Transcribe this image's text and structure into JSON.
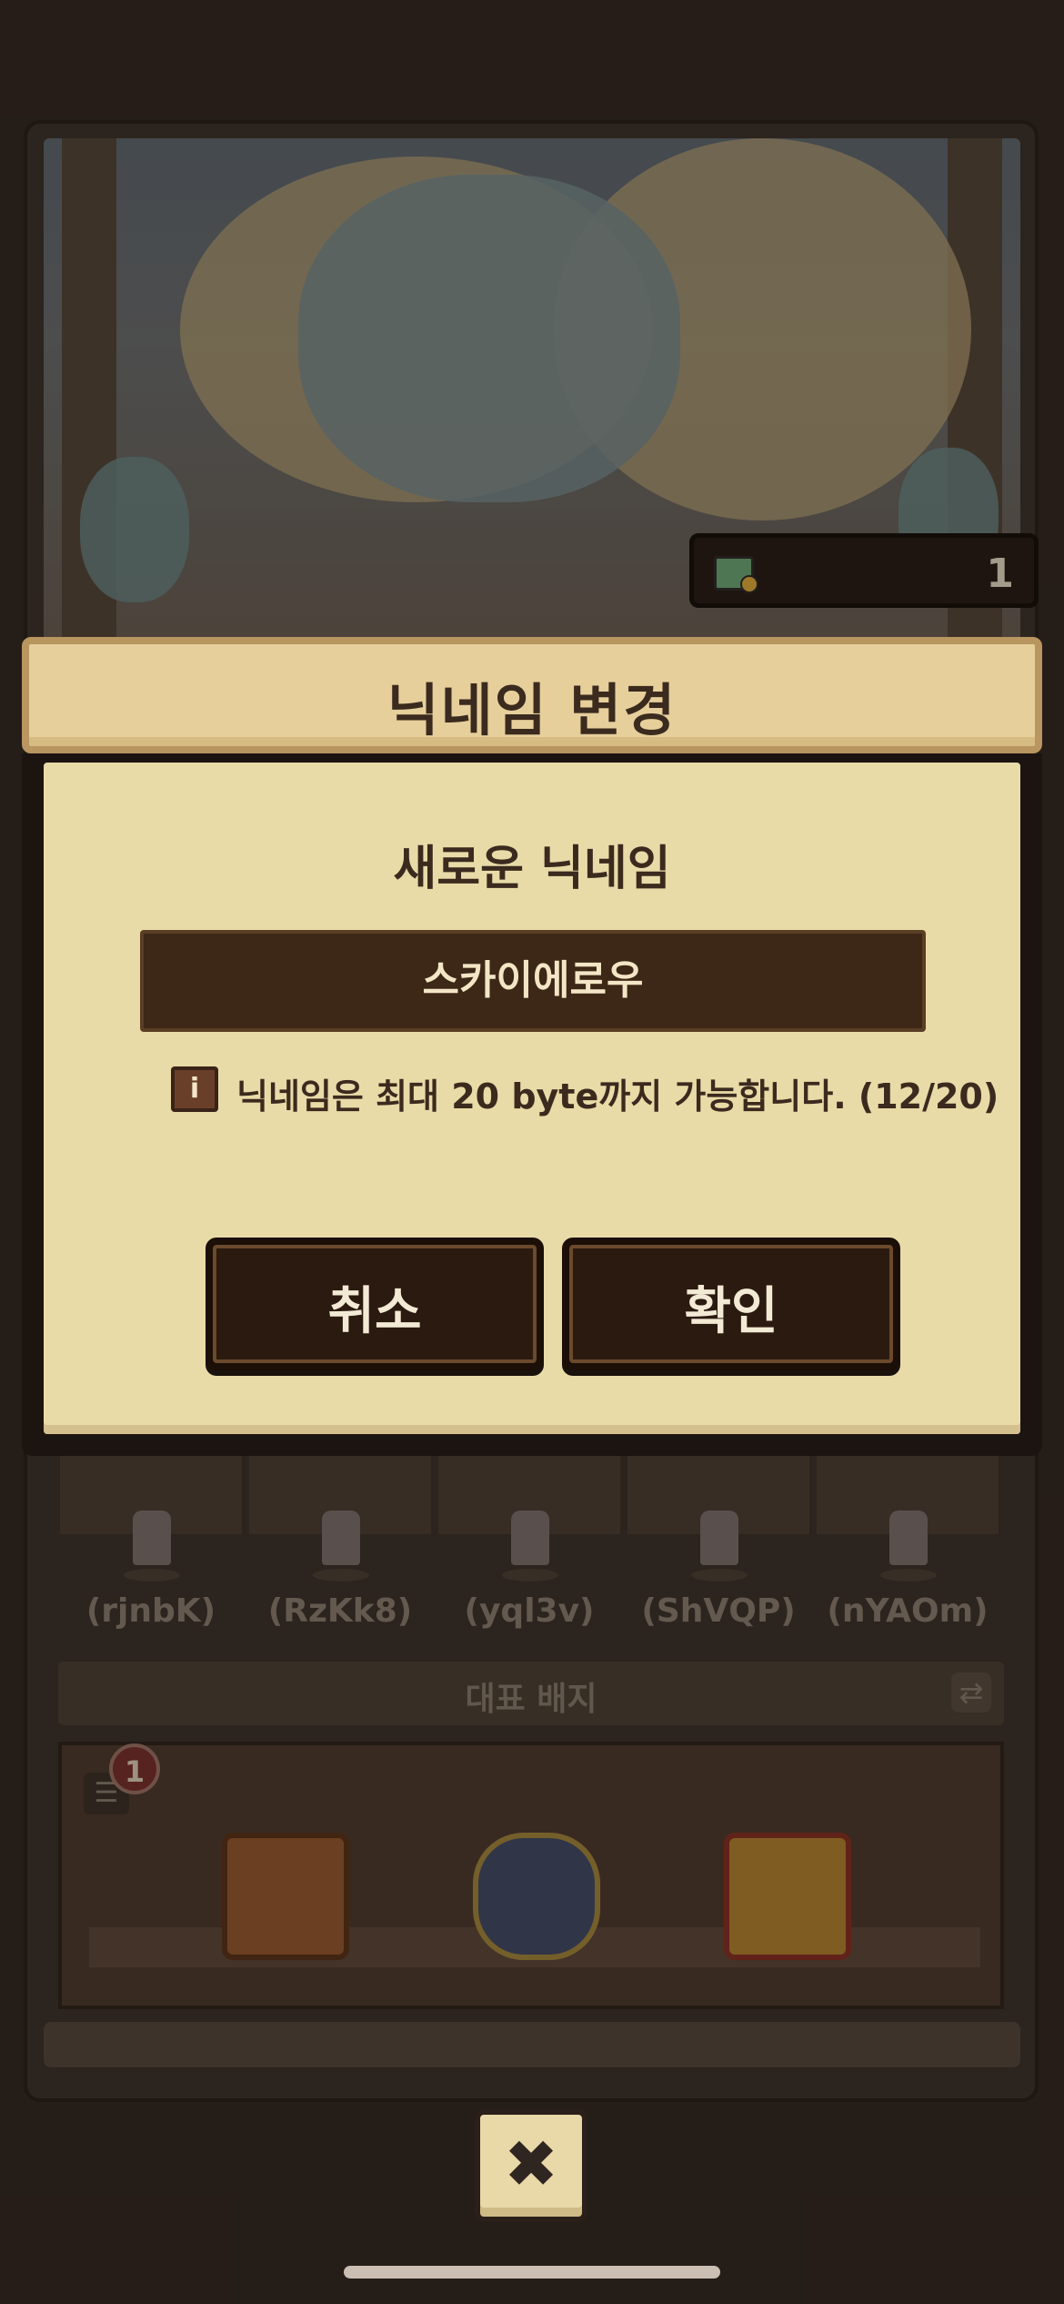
{
  "ticket_bar": {
    "count": "1",
    "icon": "ticket-icon"
  },
  "avatars": [
    {
      "name": "(rjnbK)"
    },
    {
      "name": "(RzKk8)"
    },
    {
      "name": "(yql3v)"
    },
    {
      "name": "(ShVQP)"
    },
    {
      "name": "(nYAOm)"
    }
  ],
  "badge_bar": {
    "title": "대표 배지",
    "icon": "refresh-icon"
  },
  "shelf": {
    "notification_count": "1",
    "menu_icon": "menu-icon"
  },
  "dialog": {
    "title": "닉네임 변경",
    "section_title": "새로운 닉네임",
    "nickname_value": "스카이에로우",
    "info_icon": "info-icon",
    "info_text": "닉네임은 최대 20 byte까지 가능합니다. (12/20)",
    "cancel_label": "취소",
    "confirm_label": "확인"
  },
  "close_button": {
    "icon": "close-icon",
    "glyph": "✖"
  },
  "colors": {
    "background": "#2f2521",
    "dialog_paper": "#e9dba8",
    "dialog_header": "#e6cf9b",
    "button_dark": "#2b1a0f",
    "text_dark": "#3b2a1e"
  }
}
